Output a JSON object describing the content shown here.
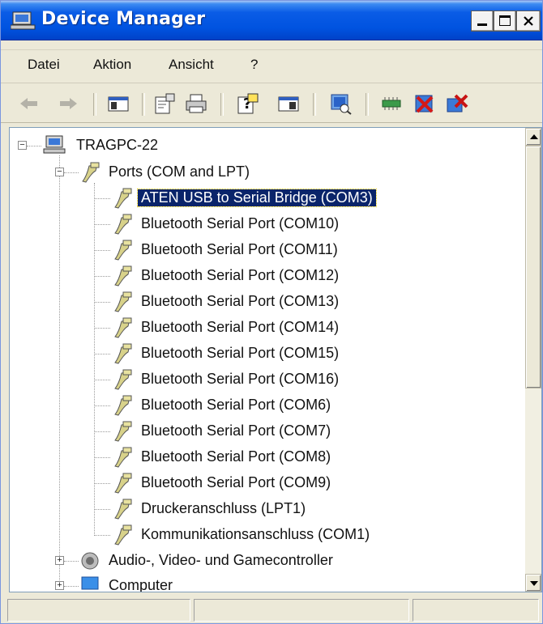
{
  "window": {
    "title": "Device Manager",
    "buttons": {
      "minimize": "minimize",
      "maximize": "maximize",
      "close": "close"
    }
  },
  "menu": [
    "Datei",
    "Aktion",
    "Ansicht",
    "?"
  ],
  "toolbar": {
    "icons": [
      "back-icon",
      "forward-icon",
      "show-hide-console-tree-icon",
      "properties-icon",
      "print-icon",
      "help-icon",
      "action-pane-icon",
      "scan-hardware-icon",
      "update-driver-icon",
      "disable-device-icon",
      "uninstall-icon"
    ]
  },
  "tree": {
    "root": "TRAGPC-22",
    "ports": {
      "label": "Ports (COM and LPT)",
      "items": [
        "ATEN USB to Serial Bridge (COM3)",
        "Bluetooth Serial Port (COM10)",
        "Bluetooth Serial Port (COM11)",
        "Bluetooth Serial Port (COM12)",
        "Bluetooth Serial Port (COM13)",
        "Bluetooth Serial Port (COM14)",
        "Bluetooth Serial Port (COM15)",
        "Bluetooth Serial Port (COM16)",
        "Bluetooth Serial Port (COM6)",
        "Bluetooth Serial Port (COM7)",
        "Bluetooth Serial Port (COM8)",
        "Bluetooth Serial Port (COM9)",
        "Druckeranschluss (LPT1)",
        "Kommunikationsanschluss (COM1)"
      ],
      "selected_index": 0
    },
    "audio": "Audio-, Video- und Gamecontroller",
    "computer": "Computer"
  },
  "colors": {
    "titlebar": "#0054e3",
    "selection": "#0a246a",
    "chrome": "#ece9d8"
  }
}
